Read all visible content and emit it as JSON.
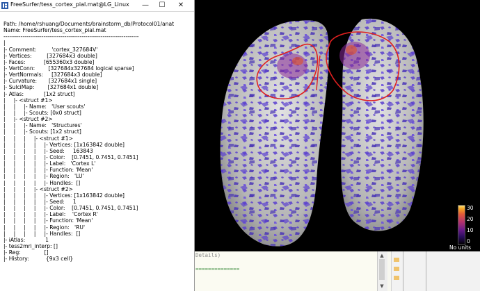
{
  "window": {
    "title": "FreeSurfer/tess_cortex_pial.mat@LG_Linux",
    "minimize": "—",
    "maximize": "☐",
    "close": "✕",
    "app_icon": "matlab-variable-icon"
  },
  "info_lines": [
    "Path: /home/rshuang/Documents/brainstorm_db/Protocol01/anat",
    "Name: FreeSurfer/tess_cortex_pial.mat",
    "-----------------------------------------------------------------------",
    "|",
    "|- Comment:         'cortex_327684V'",
    "|- Vertices:         [327684x3 double]",
    "|- Faces:           [655360x3 double]",
    "|- VertConn:        [327684x327684 logical sparse]",
    "|- VertNormals:     [327684x3 double]",
    "|- Curvature:       [327684x1 single]",
    "|- SulciMap:        [327684x1 double]",
    "|- Atlas:            [1x2 struct]",
    "|     |- <struct #1>",
    "|     |     |- Name:   'User scouts'",
    "|     |     |- Scouts: [0x0 struct]",
    "|     |- <struct #2>",
    "|     |     |- Name:   'Structures'",
    "|     |     |- Scouts: [1x2 struct]",
    "|     |     |     |- <struct #1>",
    "|     |     |     |     |- Vertices: [1x163842 double]",
    "|     |     |     |     |- Seed:     163843",
    "|     |     |     |     |- Color:    [0.7451, 0.7451, 0.7451]",
    "|     |     |     |     |- Label:   'Cortex L'",
    "|     |     |     |     |- Function: 'Mean'",
    "|     |     |     |     |- Region:   'LU'",
    "|     |     |     |     |- Handles:  []",
    "|     |     |     |- <struct #2>",
    "|     |     |     |     |- Vertices: [1x163842 double]",
    "|     |     |     |     |- Seed:     1",
    "|     |     |     |     |- Color:    [0.7451, 0.7451, 0.7451]",
    "|     |     |     |     |- Label:    'Cortex R'",
    "|     |     |     |     |- Function: 'Mean'",
    "|     |     |     |     |- Region:   'RU'",
    "|     |     |     |     |- Handles:  []",
    "|- iAtlas:            1",
    "|- tess2mri_interp: []",
    "|- Reg:              []",
    "|- History:          {9x3 cell}"
  ],
  "figure": {
    "background": "#000000",
    "cortex_color": "#c8c8c8",
    "activation_color": "#5a3fcf",
    "annotation_color": "#e02020",
    "colorbar": {
      "ticks": [
        "30",
        "20",
        "10",
        "0"
      ],
      "unit_label": "No units"
    }
  },
  "bottom": {
    "snippet": "Details)",
    "rule": "=============="
  }
}
